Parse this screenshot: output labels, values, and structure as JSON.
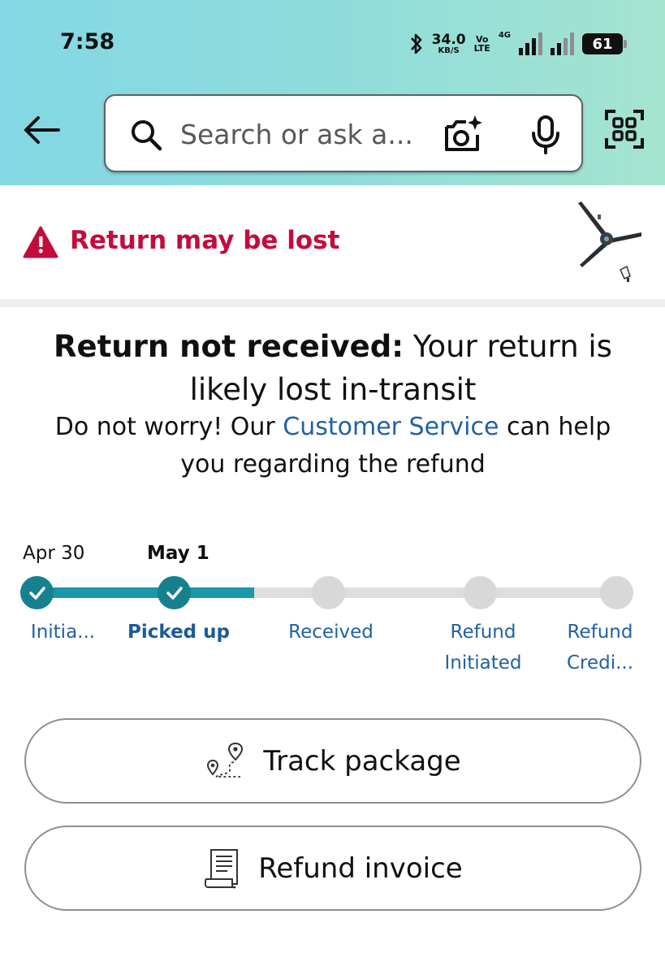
{
  "status_bar": {
    "time": "7:58",
    "net_speed": "34.0",
    "net_speed_unit": "KB/S",
    "volte_top": "Vo",
    "volte_bottom": "LTE",
    "network_type": "4G",
    "battery": "61",
    "icons": [
      "bluetooth-icon",
      "signal-icon",
      "battery-icon"
    ]
  },
  "search": {
    "placeholder": "Search or ask a..."
  },
  "header_icons": [
    "back-arrow-icon",
    "search-icon",
    "camera-lens-icon",
    "mic-icon",
    "scan-icon"
  ],
  "alert": {
    "text": "Return may be lost",
    "color": "#c40c3b",
    "icon": "warning-icon"
  },
  "message": {
    "title_bold": "Return not received:",
    "title_rest": " Your return is likely lost in-transit",
    "sub_prefix": "Do not worry! Our ",
    "sub_link": "Customer Service",
    "sub_suffix": " can help you regarding the refund"
  },
  "tracker": {
    "dates": [
      "Apr 30",
      "May 1"
    ],
    "progress_fraction": 0.375,
    "accent_color": "#1a98a8",
    "steps": [
      {
        "line1": "Initia...",
        "line2": "",
        "done": true
      },
      {
        "line1": "Picked up",
        "line2": "",
        "done": true,
        "current": true
      },
      {
        "line1": "Received",
        "line2": "",
        "done": false
      },
      {
        "line1": "Refund",
        "line2": "Initiated",
        "done": false
      },
      {
        "line1": "Refund",
        "line2": "Credi...",
        "done": false
      }
    ]
  },
  "actions": {
    "track_label": "Track package",
    "track_icon": "route-map-icon",
    "invoice_label": "Refund invoice",
    "invoice_icon": "receipt-icon"
  },
  "link_color": "#2162a1"
}
